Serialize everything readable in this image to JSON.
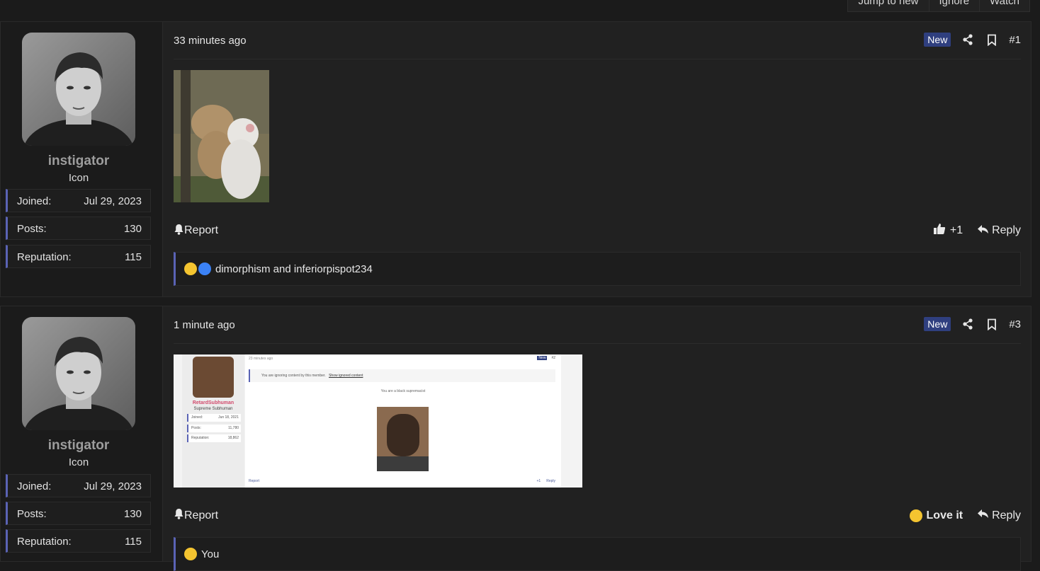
{
  "top_buttons": [
    "Jump to new",
    "Ignore",
    "Watch"
  ],
  "posts": [
    {
      "user": {
        "name": "instigator",
        "title": "Icon",
        "stats": [
          {
            "k": "Joined:",
            "v": "Jul 29, 2023"
          },
          {
            "k": "Posts:",
            "v": "130"
          },
          {
            "k": "Reputation:",
            "v": "115"
          }
        ]
      },
      "time": "33 minutes ago",
      "badge": "New",
      "number": "#1",
      "report": "Report",
      "reaction_count": "+1",
      "reply": "Reply",
      "reactors": "dimorphism and inferiorpispot234"
    },
    {
      "user": {
        "name": "instigator",
        "title": "Icon",
        "stats": [
          {
            "k": "Joined:",
            "v": "Jul 29, 2023"
          },
          {
            "k": "Posts:",
            "v": "130"
          },
          {
            "k": "Reputation:",
            "v": "115"
          }
        ]
      },
      "time": "1 minute ago",
      "badge": "New",
      "number": "#3",
      "report": "Report",
      "reaction_label": "Love it",
      "reply": "Reply",
      "reactors": "You",
      "screenshot": {
        "time": "23 minutes ago",
        "badge": "New",
        "number": "#2",
        "user": "RetardSubhuman",
        "title": "Supreme Subhuman",
        "stats": [
          {
            "k": "Joined:",
            "v": "Jun 18, 2021"
          },
          {
            "k": "Posts:",
            "v": "11,780"
          },
          {
            "k": "Reputation:",
            "v": "18,862"
          }
        ],
        "ignored_text": "You are ignoring content by this member.",
        "ignored_link": "Show ignored content",
        "quote": "You are a black supremacist",
        "report": "Report",
        "count": "+1",
        "reply": "Reply"
      }
    }
  ],
  "colors": {
    "accent": "#5a63b5",
    "badge": "#2f3f7f",
    "bg": "#1b1b1b",
    "post_bg": "#212121"
  }
}
